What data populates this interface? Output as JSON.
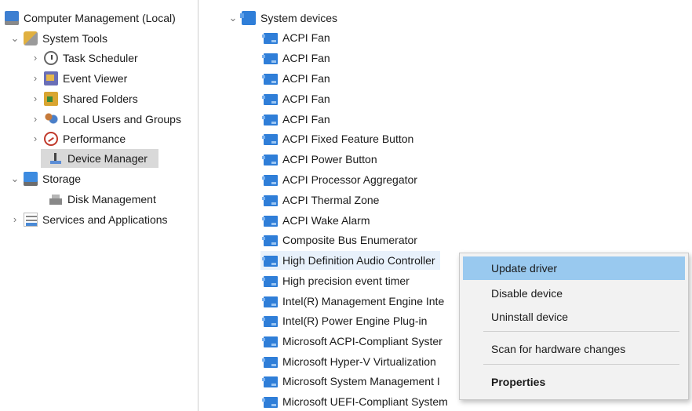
{
  "left_tree": {
    "root": "Computer Management (Local)",
    "system_tools": "System Tools",
    "task_scheduler": "Task Scheduler",
    "event_viewer": "Event Viewer",
    "shared_folders": "Shared Folders",
    "local_users": "Local Users and Groups",
    "performance": "Performance",
    "device_manager": "Device Manager",
    "storage": "Storage",
    "disk_management": "Disk Management",
    "services": "Services and Applications"
  },
  "device_tree": {
    "category": "System devices",
    "devices": [
      "ACPI Fan",
      "ACPI Fan",
      "ACPI Fan",
      "ACPI Fan",
      "ACPI Fan",
      "ACPI Fixed Feature Button",
      "ACPI Power Button",
      "ACPI Processor Aggregator",
      "ACPI Thermal Zone",
      "ACPI Wake Alarm",
      "Composite Bus Enumerator",
      "High Definition Audio Controller",
      "High precision event timer",
      "Intel(R) Management Engine Inte",
      "Intel(R) Power Engine Plug-in",
      "Microsoft ACPI-Compliant Syster",
      "Microsoft Hyper-V Virtualization",
      "Microsoft System Management I",
      "Microsoft UEFI-Compliant System"
    ]
  },
  "context_menu": {
    "update": "Update driver",
    "disable": "Disable device",
    "uninstall": "Uninstall device",
    "scan": "Scan for hardware changes",
    "properties": "Properties"
  }
}
